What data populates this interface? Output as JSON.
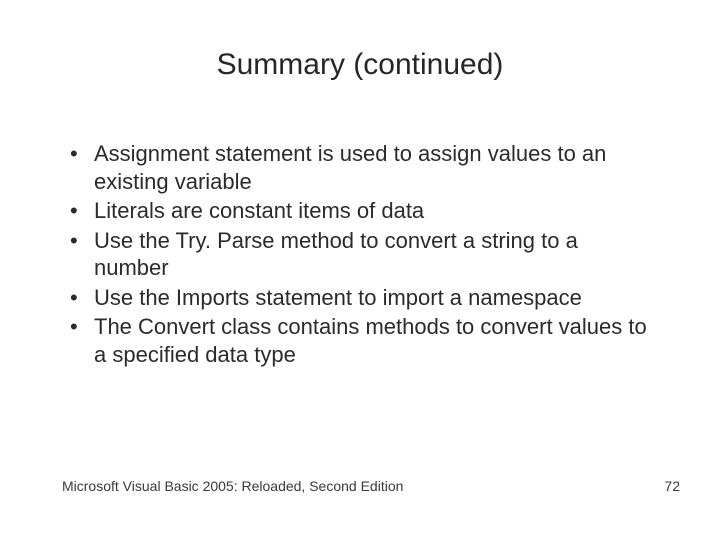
{
  "title": "Summary (continued)",
  "bullets": [
    "Assignment statement is used to assign values to an existing variable",
    "Literals are constant items of data",
    "Use the Try. Parse method to convert a string to a number",
    "Use the Imports statement to import a namespace",
    "The Convert class contains methods to convert values to a specified data type"
  ],
  "footer": {
    "source": "Microsoft Visual Basic 2005: Reloaded, Second Edition",
    "page": "72"
  }
}
